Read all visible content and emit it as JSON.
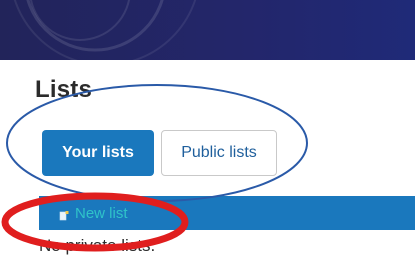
{
  "page": {
    "title": "Lists"
  },
  "tabs": [
    {
      "label": "Your lists",
      "active": true
    },
    {
      "label": "Public lists",
      "active": false
    }
  ],
  "toolbar": {
    "new_list_label": "New list",
    "new_list_icon": "new-document-icon"
  },
  "empty_state": {
    "text": "No private lists."
  },
  "colors": {
    "banner": "#23266b",
    "accent": "#1a78bd",
    "link_teal": "#2fc3c9",
    "annotation_blue": "#2a5aa8",
    "annotation_red": "#e01e1e"
  }
}
